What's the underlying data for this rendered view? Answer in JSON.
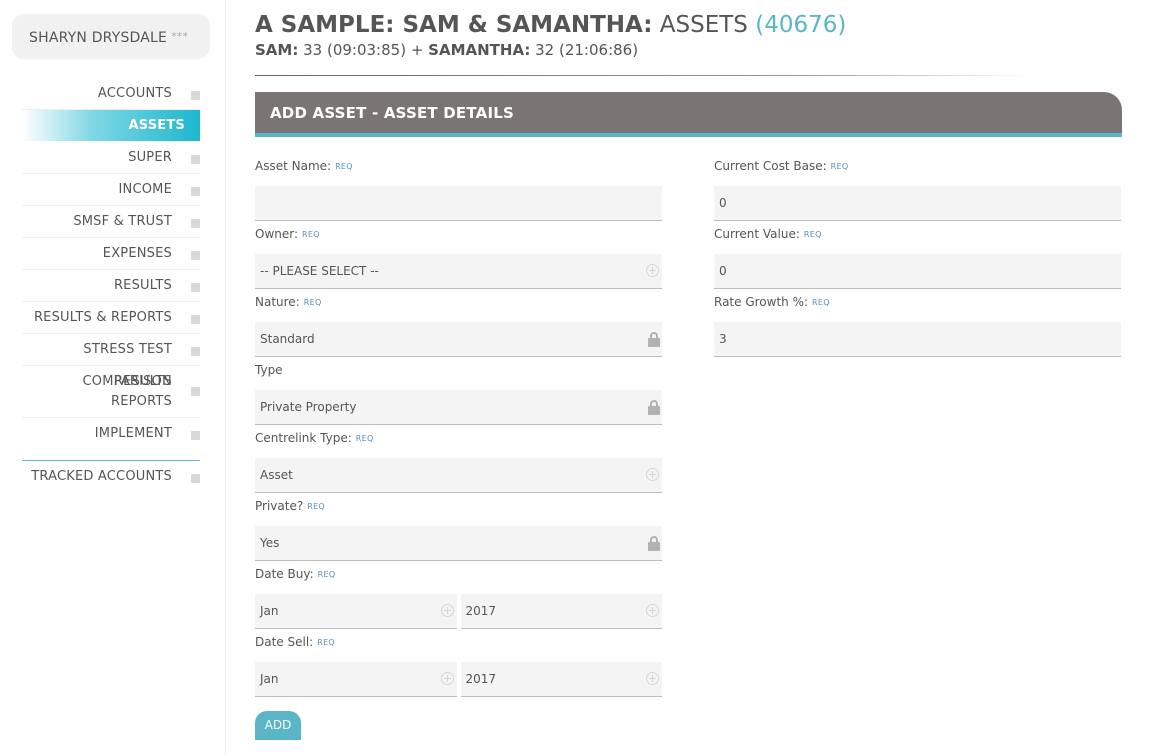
{
  "sidebar": {
    "user_name": "SHARYN DRYSDALE",
    "user_stars": "***",
    "items": [
      {
        "label": "ACCOUNTS"
      },
      {
        "label": "ASSETS"
      },
      {
        "label": "SUPER"
      },
      {
        "label": "INCOME"
      },
      {
        "label": "SMSF & TRUST"
      },
      {
        "label": "EXPENSES"
      },
      {
        "label": "RESULTS"
      },
      {
        "label": "RESULTS & REPORTS"
      },
      {
        "label": "STRESS TEST RESULTS"
      },
      {
        "label_line1": "COMPARISON",
        "label_line2": "REPORTS"
      },
      {
        "label": "IMPLEMENT"
      }
    ],
    "tracked_label": "TRACKED ACCOUNTS"
  },
  "header": {
    "title_strong": "A SAMPLE: SAM & SAMANTHA:",
    "title_light": "ASSETS",
    "title_count": "(40676)",
    "sub_name1": "SAM:",
    "sub_val1": "33 (09:03:85) +",
    "sub_name2": "SAMANTHA:",
    "sub_val2": "32 (21:06:86)"
  },
  "panel": {
    "title": "ADD ASSET - ASSET DETAILS"
  },
  "req_tag": "REQ",
  "form": {
    "asset_name": {
      "label": "Asset Name:",
      "value": ""
    },
    "owner": {
      "label": "Owner:",
      "value": "-- PLEASE SELECT --"
    },
    "nature": {
      "label": "Nature:",
      "value": "Standard"
    },
    "type": {
      "label": "Type",
      "value": "Private Property"
    },
    "centrelink": {
      "label": "Centrelink Type:",
      "value": "Asset"
    },
    "private": {
      "label": "Private?",
      "value": "Yes"
    },
    "date_buy": {
      "label": "Date Buy:",
      "month": "Jan",
      "year": "2017"
    },
    "date_sell": {
      "label": "Date Sell:",
      "month": "Jan",
      "year": "2017"
    },
    "cost_base": {
      "label": "Current Cost Base:",
      "value": "0"
    },
    "current_value": {
      "label": "Current Value:",
      "value": "0"
    },
    "rate_growth": {
      "label": "Rate Growth %:",
      "value": "3"
    }
  },
  "add_button": "ADD",
  "colors": {
    "accent": "#5ab6c6",
    "active_nav": "#1cb7cf",
    "panel_header": "#797574"
  }
}
